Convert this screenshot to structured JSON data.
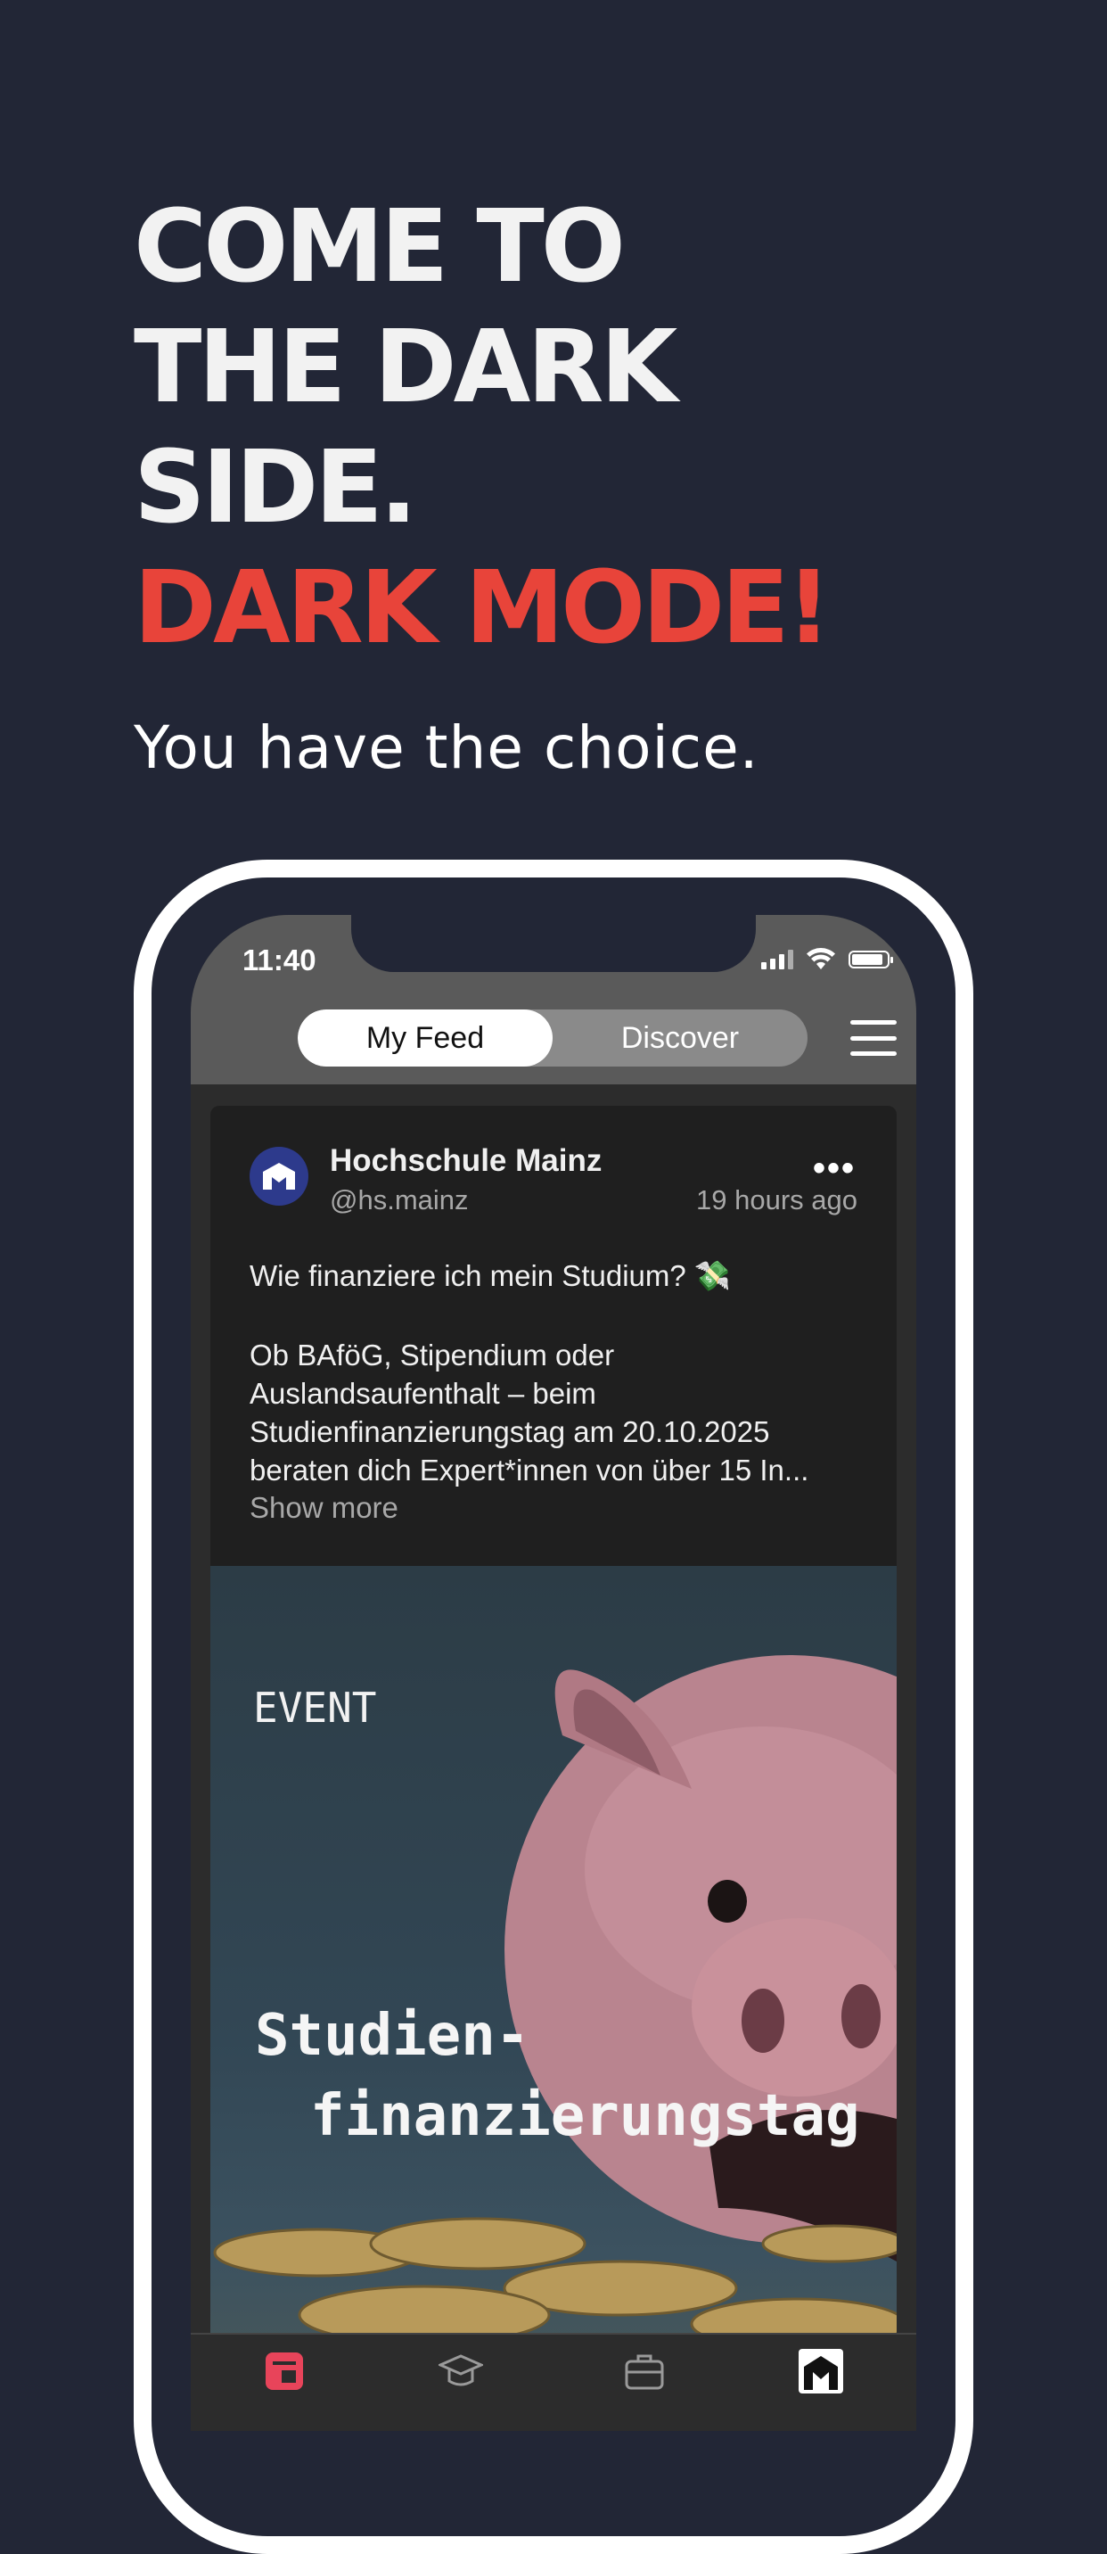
{
  "promo": {
    "headline_lines": [
      "COME TO",
      "THE DARK",
      "SIDE."
    ],
    "accent": "DARK MODE!",
    "subline": "You have the choice."
  },
  "status_bar": {
    "time": "11:40"
  },
  "feed_switch": {
    "my_feed": "My Feed",
    "discover": "Discover",
    "active": "My Feed"
  },
  "post": {
    "author": "Hochschule Mainz",
    "handle": "@hs.mainz",
    "time_ago": "19 hours ago",
    "title": "Wie finanziere ich mein Studium? 💸",
    "body": "Ob BAföG, Stipendium oder Auslandsaufenthalt – beim Studienfinanzierungstag am 20.10.2025 beraten dich Expert*innen von über 15 In...",
    "show_more": "Show more",
    "image": {
      "label": "EVENT",
      "title_line1": "Studien-",
      "title_line2": "finanzierungstag"
    }
  },
  "tabs": [
    "feed-icon",
    "graduation-cap-icon",
    "briefcase-icon",
    "university-logo-icon"
  ],
  "colors": {
    "background": "#222636",
    "accent": "#e8443a",
    "card": "#1f1f1f"
  }
}
